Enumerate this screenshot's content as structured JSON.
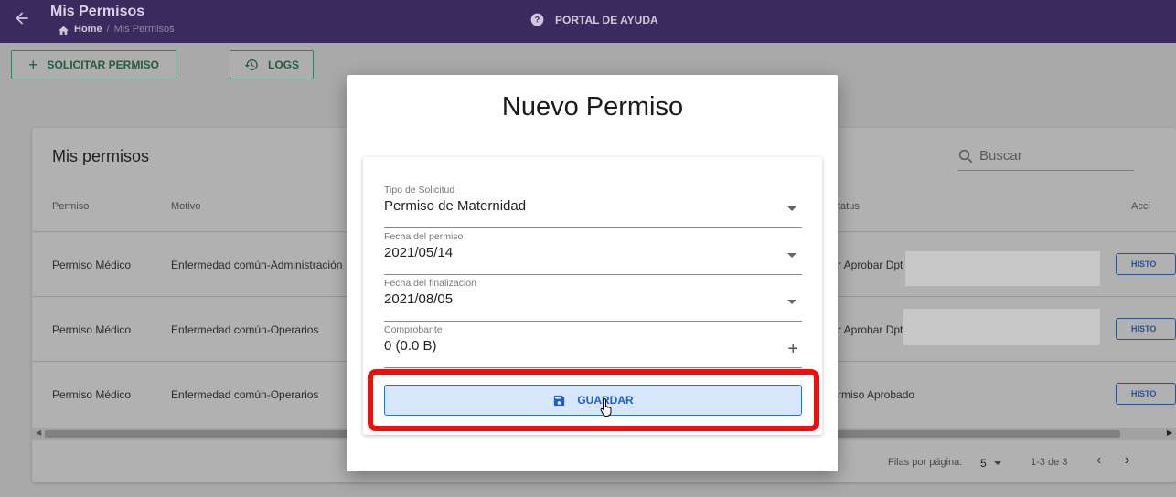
{
  "header": {
    "title": "Mis Permisos",
    "breadcrumb": {
      "home": "Home",
      "separator": "/",
      "current": "Mis Permisos"
    },
    "help_label": "PORTAL DE AYUDA",
    "bar_color": "#3b2a5e"
  },
  "actions": {
    "solicitar_label": "SOLICITAR PERMISO",
    "logs_label": "LOGS"
  },
  "table": {
    "title": "Mis permisos",
    "search_placeholder": "Buscar",
    "columns": [
      "Permiso",
      "Motivo",
      "tatus",
      "Acci"
    ],
    "rows": [
      {
        "permiso": "Permiso Médico",
        "motivo": "Enfermedad común-Administración",
        "status": "r Aprobar Dpt",
        "accion": "HISTO"
      },
      {
        "permiso": "Permiso Médico",
        "motivo": "Enfermedad común-Operarios",
        "status": "r Aprobar Dpt",
        "accion": "HISTO"
      },
      {
        "permiso": "Permiso Médico",
        "motivo": "Enfermedad común-Operarios",
        "status": "rmiso Aprobado",
        "accion": "HISTO"
      }
    ],
    "pagination": {
      "rows_per_page_label": "Filas por página:",
      "rows_per_page": "5",
      "range": "1-3 de 3"
    }
  },
  "modal": {
    "title": "Nuevo Permiso",
    "fields": [
      {
        "label": "Tipo de Solicitud",
        "value": "Permiso de Maternidad",
        "control": "dropdown"
      },
      {
        "label": "Fecha del permiso",
        "value": "2021/05/14",
        "control": "dropdown"
      },
      {
        "label": "Fecha del finalizacion",
        "value": "2021/08/05",
        "control": "dropdown"
      },
      {
        "label": "Comprobante",
        "value": "0 (0.0 B)",
        "control": "add"
      }
    ],
    "save_label": "GUARDAR",
    "highlight_color": "#f20d0d",
    "accent_color": "#1f5fc0"
  }
}
